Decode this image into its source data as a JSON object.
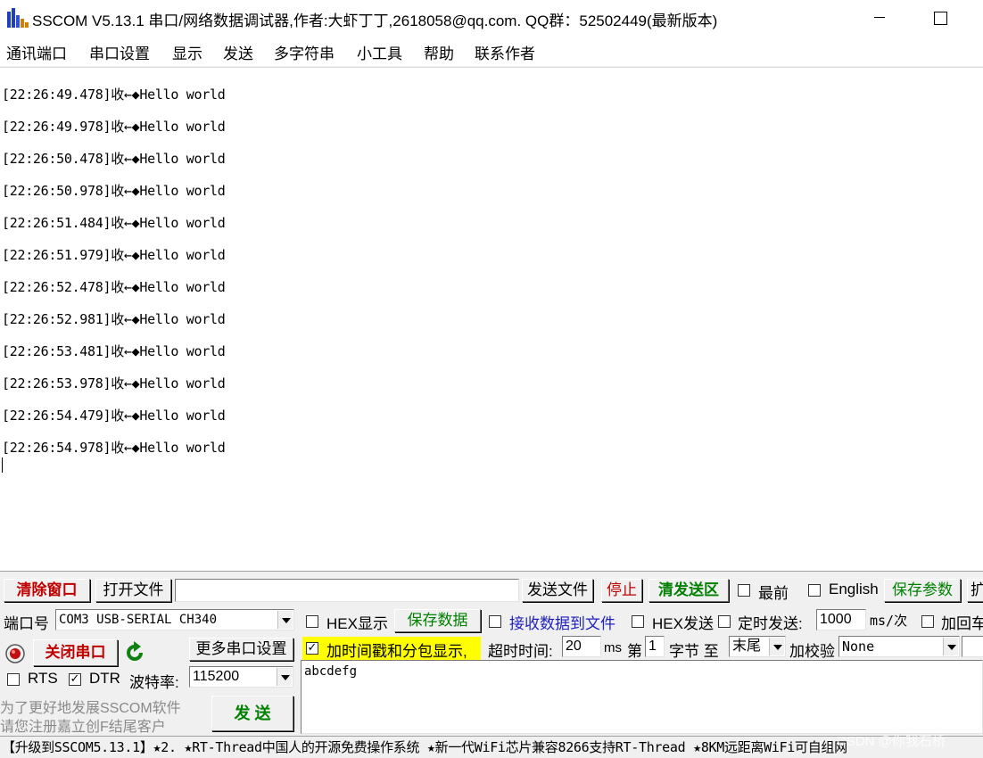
{
  "window": {
    "title": "SSCOM V5.13.1 串口/网络数据调试器,作者:大虾丁丁,2618058@qq.com. QQ群：52502449(最新版本)"
  },
  "menu": [
    "通讯端口",
    "串口设置",
    "显示",
    "发送",
    "多字符串",
    "小工具",
    "帮助",
    "联系作者"
  ],
  "receive": {
    "lines": [
      "[22:26:49.478]收←◆Hello world",
      "[22:26:49.978]收←◆Hello world",
      "[22:26:50.478]收←◆Hello world",
      "[22:26:50.978]收←◆Hello world",
      "[22:26:51.484]收←◆Hello world",
      "[22:26:51.979]收←◆Hello world",
      "[22:26:52.478]收←◆Hello world",
      "[22:26:52.981]收←◆Hello world",
      "[22:26:53.481]收←◆Hello world",
      "[22:26:53.978]收←◆Hello world",
      "[22:26:54.479]收←◆Hello world",
      "[22:26:54.978]收←◆Hello world"
    ]
  },
  "toolbar": {
    "clear_window": "清除窗口",
    "open_file": "打开文件",
    "file_path": "",
    "send_file": "发送文件",
    "stop": "停止",
    "clear_send": "清发送区",
    "topmost": "最前",
    "english": "English",
    "save_params": "保存参数",
    "expand": "扩"
  },
  "port": {
    "port_label": "端口号",
    "port_value": "COM3 USB-SERIAL CH340",
    "close_port": "关闭串口",
    "more_settings": "更多串口设置",
    "rts": "RTS",
    "dtr": "DTR",
    "baud_label": "波特率:",
    "baud_value": "115200",
    "rts_checked": false,
    "dtr_checked": true
  },
  "options": {
    "hex_display": "HEX显示",
    "save_data": "保存数据",
    "recv_to_file": "接收数据到文件",
    "hex_send": "HEX发送",
    "timed_send": "定时发送:",
    "interval": "1000",
    "interval_unit": "ms/次",
    "add_crlf": "加回车",
    "timestamp": "加时间戳和分包显示,",
    "timeout_label": "超时时间:",
    "timeout_value": "20",
    "timeout_unit": "ms",
    "nth_label": "第",
    "nth_value": "1",
    "byte_label": "字节 至",
    "end_value": "末尾",
    "checksum_label": "加校验",
    "checksum_value": "None",
    "timestamp_checked": true
  },
  "send": {
    "text": "abcdefg",
    "button": "发  送",
    "promo_line1": "为了更好地发展SSCOM软件",
    "promo_line2": "请您注册嘉立创F结尾客户"
  },
  "status": {
    "text": "【升级到SSCOM5.13.1】★2. ★RT-Thread中国人的开源免费操作系统 ★新一代WiFi芯片兼容8266支持RT-Thread ★8KM远距离WiFi可自组网"
  },
  "watermark": "CSDN @你我石桥",
  "colors": {
    "accent_red": "#c00000",
    "accent_green": "#008000",
    "accent_blue": "#1f1fbf",
    "highlight_yellow": "#ffff00"
  }
}
